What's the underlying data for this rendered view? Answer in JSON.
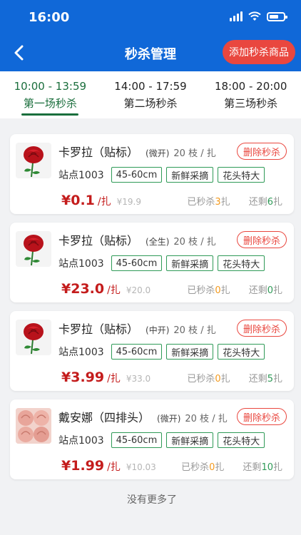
{
  "status": {
    "time": "16:00"
  },
  "nav": {
    "title": "秒杀管理",
    "add_label": "添加秒杀商品"
  },
  "tabs": [
    {
      "time": "10:00 - 13:59",
      "label": "第一场秒杀",
      "active": true
    },
    {
      "time": "14:00 - 17:59",
      "label": "第二场秒杀",
      "active": false
    },
    {
      "time": "18:00 - 20:00",
      "label": "第三场秒杀",
      "active": false
    }
  ],
  "items": [
    {
      "name": "卡罗拉（贴标）",
      "open": "(微开)",
      "qty": "20 枝 / 扎",
      "delete_label": "删除秒杀",
      "station": "站点1003",
      "tags": [
        "45-60cm",
        "新鲜采摘",
        "花头特大"
      ],
      "price": "¥0.1",
      "unit": "/扎",
      "original": "¥19.9",
      "sold_prefix": "已秒杀",
      "sold_count": "3",
      "sold_suffix": "扎",
      "left_prefix": "还剩",
      "left_count": "6",
      "left_suffix": "扎",
      "image": "red-rose-icon"
    },
    {
      "name": "卡罗拉（贴标）",
      "open": "(全生)",
      "qty": "20 枝 / 扎",
      "delete_label": "删除秒杀",
      "station": "站点1003",
      "tags": [
        "45-60cm",
        "新鲜采摘",
        "花头特大"
      ],
      "price": "¥23.0",
      "unit": "/扎",
      "original": "¥20.0",
      "sold_prefix": "已秒杀",
      "sold_count": "0",
      "sold_suffix": "扎",
      "left_prefix": "还剩",
      "left_count": "0",
      "left_suffix": "扎",
      "image": "red-rose-icon"
    },
    {
      "name": "卡罗拉（贴标）",
      "open": "(中开)",
      "qty": "20 枝 / 扎",
      "delete_label": "删除秒杀",
      "station": "站点1003",
      "tags": [
        "45-60cm",
        "新鲜采摘",
        "花头特大"
      ],
      "price": "¥3.99",
      "unit": "/扎",
      "original": "¥33.0",
      "sold_prefix": "已秒杀",
      "sold_count": "0",
      "sold_suffix": "扎",
      "left_prefix": "还剩",
      "left_count": "5",
      "left_suffix": "扎",
      "image": "red-rose-icon"
    },
    {
      "name": "戴安娜（四排头）",
      "open": "(微开)",
      "qty": "20 枝 / 扎",
      "delete_label": "删除秒杀",
      "station": "站点1003",
      "tags": [
        "45-60cm",
        "新鲜采摘",
        "花头特大"
      ],
      "price": "¥1.99",
      "unit": "/扎",
      "original": "¥10.03",
      "sold_prefix": "已秒杀",
      "sold_count": "0",
      "sold_suffix": "扎",
      "left_prefix": "还剩",
      "left_count": "10",
      "left_suffix": "扎",
      "image": "pink-rose-icon"
    }
  ],
  "footer": {
    "no_more": "没有更多了"
  },
  "colors": {
    "primary": "#1068d8",
    "accent_red": "#e9473f",
    "green": "#1a6e3c"
  }
}
